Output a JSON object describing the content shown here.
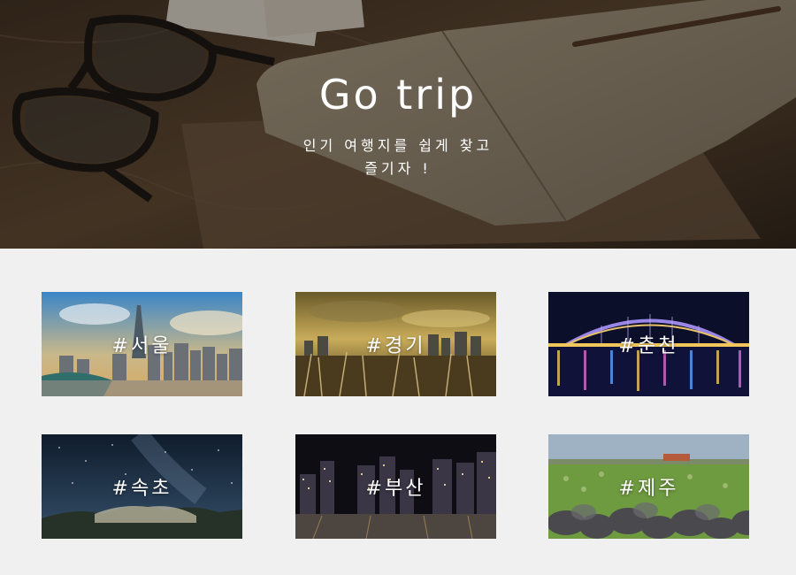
{
  "hero": {
    "title": "Go trip",
    "subtitle_line1": "인기 여행지를 쉽게 찾고",
    "subtitle_line2": "즐기자 !"
  },
  "destinations": [
    {
      "label": "#서울"
    },
    {
      "label": "#경기"
    },
    {
      "label": "#춘천"
    },
    {
      "label": "#속초"
    },
    {
      "label": "#부산"
    },
    {
      "label": "#제주"
    }
  ],
  "colors": {
    "page_background": "#f0f0f0",
    "text": "#ffffff"
  }
}
